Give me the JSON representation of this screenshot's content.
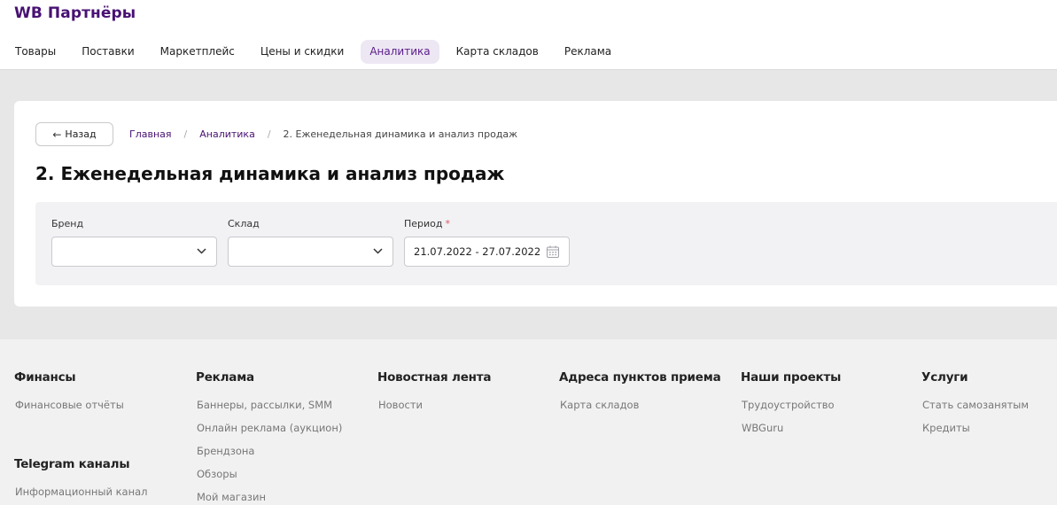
{
  "header": {
    "logo": "WB Партнёры",
    "nav": [
      {
        "label": "Товары"
      },
      {
        "label": "Поставки"
      },
      {
        "label": "Маркетплейс"
      },
      {
        "label": "Цены и скидки"
      },
      {
        "label": "Аналитика",
        "active": true
      },
      {
        "label": "Карта складов"
      },
      {
        "label": "Реклама"
      }
    ]
  },
  "page": {
    "back_label": "Назад",
    "back_icon": "arrow-left-icon",
    "breadcrumb": [
      "Главная",
      "Аналитика",
      "2. Еженедельная динамика и анализ продаж"
    ],
    "breadcrumb_separator": "/",
    "title": "2. Еженедельная динамика и анализ продаж"
  },
  "filters": {
    "brand_label": "Бренд",
    "brand_value": "",
    "warehouse_label": "Склад",
    "warehouse_value": "",
    "period_label": "Период",
    "period_required_mark": "*",
    "period_value": "21.07.2022 - 27.07.2022",
    "period_icon": "calendar-icon"
  },
  "footer": {
    "col1": {
      "title": "Финансы",
      "links": [
        "Финансовые отчёты"
      ]
    },
    "col1b": {
      "title": "Telegram каналы",
      "links": [
        "Информационный канал"
      ]
    },
    "col2": {
      "title": "Реклама",
      "links": [
        "Баннеры, рассылки, SMM",
        "Онлайн реклама (аукцион)",
        "Брендзона",
        "Обзоры",
        "Мой магазин"
      ]
    },
    "col3": {
      "title": "Новостная лента",
      "links": [
        "Новости"
      ]
    },
    "col4": {
      "title": "Адреса пунктов приема",
      "links": [
        "Карта складов"
      ]
    },
    "col5": {
      "title": "Наши проекты",
      "links": [
        "Трудоустройство",
        "WBGuru"
      ]
    },
    "col6": {
      "title": "Услуги",
      "links": [
        "Стать самозанятым",
        "Кредиты"
      ]
    }
  },
  "colors": {
    "brand": "#481173",
    "active_tab_bg": "#ede7f3",
    "page_bg": "#e7e7e7",
    "filter_bg": "#f2f2f5",
    "footer_bg": "#f1f1f1",
    "required": "#e0565c"
  }
}
